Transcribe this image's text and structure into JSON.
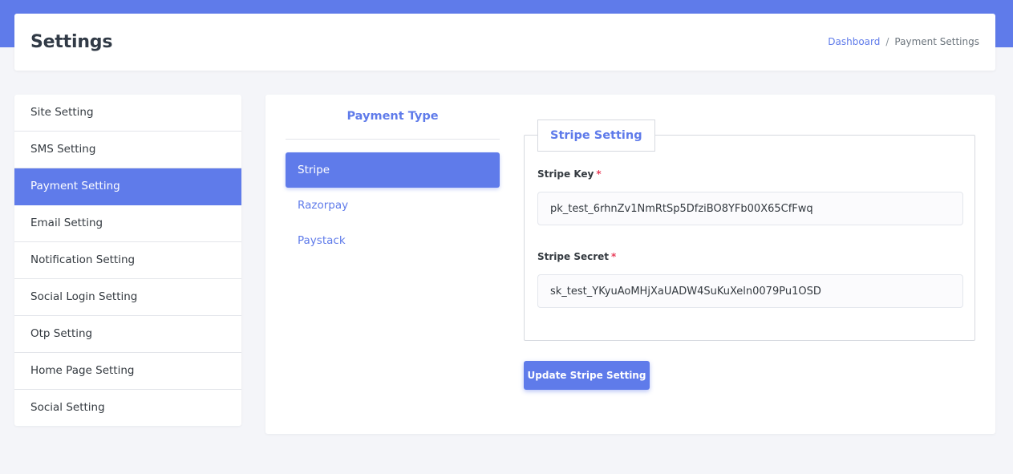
{
  "header": {
    "title": "Settings",
    "breadcrumb": {
      "link": "Dashboard",
      "separator": "/",
      "current": "Payment Settings"
    }
  },
  "sidebar": {
    "items": [
      {
        "label": "Site Setting",
        "active": false
      },
      {
        "label": "SMS Setting",
        "active": false
      },
      {
        "label": "Payment Setting",
        "active": true
      },
      {
        "label": "Email Setting",
        "active": false
      },
      {
        "label": "Notification Setting",
        "active": false
      },
      {
        "label": "Social Login Setting",
        "active": false
      },
      {
        "label": "Otp Setting",
        "active": false
      },
      {
        "label": "Home Page Setting",
        "active": false
      },
      {
        "label": "Social Setting",
        "active": false
      }
    ]
  },
  "payment_type": {
    "title": "Payment Type",
    "items": [
      {
        "label": "Stripe",
        "active": true
      },
      {
        "label": "Razorpay",
        "active": false
      },
      {
        "label": "Paystack",
        "active": false
      }
    ]
  },
  "stripe_form": {
    "legend": "Stripe Setting",
    "key_label": "Stripe Key",
    "key_value": "pk_test_6rhnZv1NmRtSp5DfziBO8YFb00X65CfFwq",
    "secret_label": "Stripe Secret",
    "secret_value": "sk_test_YKyuAoMHjXaUADW4SuKuXeln0079Pu1OSD",
    "required_marker": "*",
    "submit_label": "Update Stripe Setting"
  },
  "colors": {
    "accent": "#5f7bea",
    "background": "#f4f5f9",
    "required": "#e83e5a"
  }
}
